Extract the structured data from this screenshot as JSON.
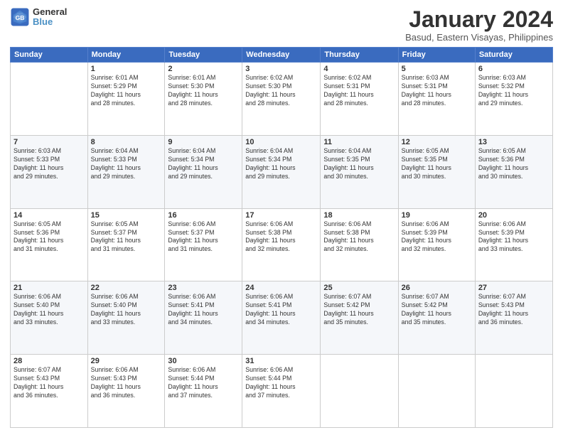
{
  "header": {
    "logo_line1": "General",
    "logo_line2": "Blue",
    "month": "January 2024",
    "location": "Basud, Eastern Visayas, Philippines"
  },
  "weekdays": [
    "Sunday",
    "Monday",
    "Tuesday",
    "Wednesday",
    "Thursday",
    "Friday",
    "Saturday"
  ],
  "weeks": [
    [
      {
        "num": "",
        "info": ""
      },
      {
        "num": "1",
        "info": "Sunrise: 6:01 AM\nSunset: 5:29 PM\nDaylight: 11 hours\nand 28 minutes."
      },
      {
        "num": "2",
        "info": "Sunrise: 6:01 AM\nSunset: 5:30 PM\nDaylight: 11 hours\nand 28 minutes."
      },
      {
        "num": "3",
        "info": "Sunrise: 6:02 AM\nSunset: 5:30 PM\nDaylight: 11 hours\nand 28 minutes."
      },
      {
        "num": "4",
        "info": "Sunrise: 6:02 AM\nSunset: 5:31 PM\nDaylight: 11 hours\nand 28 minutes."
      },
      {
        "num": "5",
        "info": "Sunrise: 6:03 AM\nSunset: 5:31 PM\nDaylight: 11 hours\nand 28 minutes."
      },
      {
        "num": "6",
        "info": "Sunrise: 6:03 AM\nSunset: 5:32 PM\nDaylight: 11 hours\nand 29 minutes."
      }
    ],
    [
      {
        "num": "7",
        "info": "Sunrise: 6:03 AM\nSunset: 5:33 PM\nDaylight: 11 hours\nand 29 minutes."
      },
      {
        "num": "8",
        "info": "Sunrise: 6:04 AM\nSunset: 5:33 PM\nDaylight: 11 hours\nand 29 minutes."
      },
      {
        "num": "9",
        "info": "Sunrise: 6:04 AM\nSunset: 5:34 PM\nDaylight: 11 hours\nand 29 minutes."
      },
      {
        "num": "10",
        "info": "Sunrise: 6:04 AM\nSunset: 5:34 PM\nDaylight: 11 hours\nand 29 minutes."
      },
      {
        "num": "11",
        "info": "Sunrise: 6:04 AM\nSunset: 5:35 PM\nDaylight: 11 hours\nand 30 minutes."
      },
      {
        "num": "12",
        "info": "Sunrise: 6:05 AM\nSunset: 5:35 PM\nDaylight: 11 hours\nand 30 minutes."
      },
      {
        "num": "13",
        "info": "Sunrise: 6:05 AM\nSunset: 5:36 PM\nDaylight: 11 hours\nand 30 minutes."
      }
    ],
    [
      {
        "num": "14",
        "info": "Sunrise: 6:05 AM\nSunset: 5:36 PM\nDaylight: 11 hours\nand 31 minutes."
      },
      {
        "num": "15",
        "info": "Sunrise: 6:05 AM\nSunset: 5:37 PM\nDaylight: 11 hours\nand 31 minutes."
      },
      {
        "num": "16",
        "info": "Sunrise: 6:06 AM\nSunset: 5:37 PM\nDaylight: 11 hours\nand 31 minutes."
      },
      {
        "num": "17",
        "info": "Sunrise: 6:06 AM\nSunset: 5:38 PM\nDaylight: 11 hours\nand 32 minutes."
      },
      {
        "num": "18",
        "info": "Sunrise: 6:06 AM\nSunset: 5:38 PM\nDaylight: 11 hours\nand 32 minutes."
      },
      {
        "num": "19",
        "info": "Sunrise: 6:06 AM\nSunset: 5:39 PM\nDaylight: 11 hours\nand 32 minutes."
      },
      {
        "num": "20",
        "info": "Sunrise: 6:06 AM\nSunset: 5:39 PM\nDaylight: 11 hours\nand 33 minutes."
      }
    ],
    [
      {
        "num": "21",
        "info": "Sunrise: 6:06 AM\nSunset: 5:40 PM\nDaylight: 11 hours\nand 33 minutes."
      },
      {
        "num": "22",
        "info": "Sunrise: 6:06 AM\nSunset: 5:40 PM\nDaylight: 11 hours\nand 33 minutes."
      },
      {
        "num": "23",
        "info": "Sunrise: 6:06 AM\nSunset: 5:41 PM\nDaylight: 11 hours\nand 34 minutes."
      },
      {
        "num": "24",
        "info": "Sunrise: 6:06 AM\nSunset: 5:41 PM\nDaylight: 11 hours\nand 34 minutes."
      },
      {
        "num": "25",
        "info": "Sunrise: 6:07 AM\nSunset: 5:42 PM\nDaylight: 11 hours\nand 35 minutes."
      },
      {
        "num": "26",
        "info": "Sunrise: 6:07 AM\nSunset: 5:42 PM\nDaylight: 11 hours\nand 35 minutes."
      },
      {
        "num": "27",
        "info": "Sunrise: 6:07 AM\nSunset: 5:43 PM\nDaylight: 11 hours\nand 36 minutes."
      }
    ],
    [
      {
        "num": "28",
        "info": "Sunrise: 6:07 AM\nSunset: 5:43 PM\nDaylight: 11 hours\nand 36 minutes."
      },
      {
        "num": "29",
        "info": "Sunrise: 6:06 AM\nSunset: 5:43 PM\nDaylight: 11 hours\nand 36 minutes."
      },
      {
        "num": "30",
        "info": "Sunrise: 6:06 AM\nSunset: 5:44 PM\nDaylight: 11 hours\nand 37 minutes."
      },
      {
        "num": "31",
        "info": "Sunrise: 6:06 AM\nSunset: 5:44 PM\nDaylight: 11 hours\nand 37 minutes."
      },
      {
        "num": "",
        "info": ""
      },
      {
        "num": "",
        "info": ""
      },
      {
        "num": "",
        "info": ""
      }
    ]
  ]
}
